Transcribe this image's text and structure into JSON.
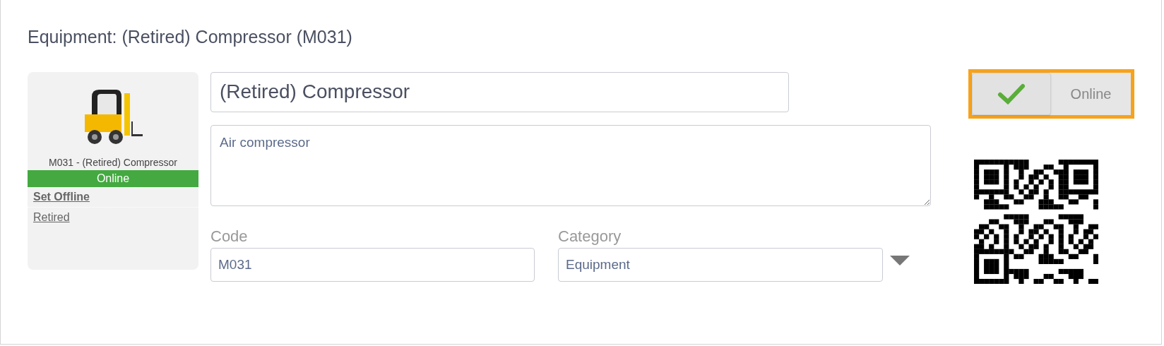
{
  "title": "Equipment: (Retired) Compressor (M031)",
  "card": {
    "caption": "M031 - (Retired) Compressor",
    "status": "Online",
    "online": true,
    "links": [
      {
        "label": "Set Offline",
        "bold": true
      },
      {
        "label": "Retired",
        "bold": false
      }
    ]
  },
  "name": {
    "value": "(Retired) Compressor"
  },
  "description": {
    "value": "Air compressor"
  },
  "code": {
    "label": "Code",
    "value": "M031"
  },
  "category": {
    "label": "Category",
    "value": "Equipment"
  },
  "toggle": {
    "label": "Online",
    "on": true
  }
}
